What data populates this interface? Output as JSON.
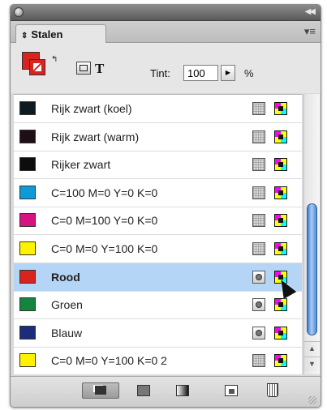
{
  "panel": {
    "tab_label": "Stalen",
    "tab_arrows": "⇕",
    "collapse_glyph": "◀◀",
    "menu_glyph": "▾≡"
  },
  "toolbar": {
    "tint_label": "Tint:",
    "tint_value": "100",
    "tint_unit": "%",
    "text_button_label": "T",
    "fill_color": "#d7241f"
  },
  "swatches": [
    {
      "name": "Rijk zwart (koel)",
      "color": "#0e1a20",
      "type": "process",
      "mode": "cmyk"
    },
    {
      "name": "Rijk zwart (warm)",
      "color": "#1e0f16",
      "type": "process",
      "mode": "cmyk"
    },
    {
      "name": "Rijker zwart",
      "color": "#0d0d0d",
      "type": "process",
      "mode": "cmyk"
    },
    {
      "name": "C=100 M=0 Y=0 K=0",
      "color": "#0e9ad7",
      "type": "process",
      "mode": "cmyk"
    },
    {
      "name": "C=0 M=100 Y=0 K=0",
      "color": "#d6137f",
      "type": "process",
      "mode": "cmyk"
    },
    {
      "name": "C=0 M=0 Y=100 K=0",
      "color": "#fff200",
      "type": "process",
      "mode": "cmyk"
    },
    {
      "name": "Rood",
      "color": "#d7241f",
      "type": "spot",
      "mode": "cmyk",
      "selected": true
    },
    {
      "name": "Groen",
      "color": "#14853e",
      "type": "spot",
      "mode": "cmyk"
    },
    {
      "name": "Blauw",
      "color": "#1c2c7c",
      "type": "spot",
      "mode": "cmyk"
    },
    {
      "name": "C=0 M=0 Y=100 K=0 2",
      "color": "#fff200",
      "type": "process",
      "mode": "cmyk"
    }
  ],
  "scrollbar": {
    "up_glyph": "▲",
    "down_glyph": "▼"
  },
  "footer": {
    "icons": [
      "show-all-swatches-icon",
      "show-color-swatches-icon",
      "show-gradient-swatches-icon",
      "new-swatch-icon",
      "trash-icon"
    ]
  }
}
